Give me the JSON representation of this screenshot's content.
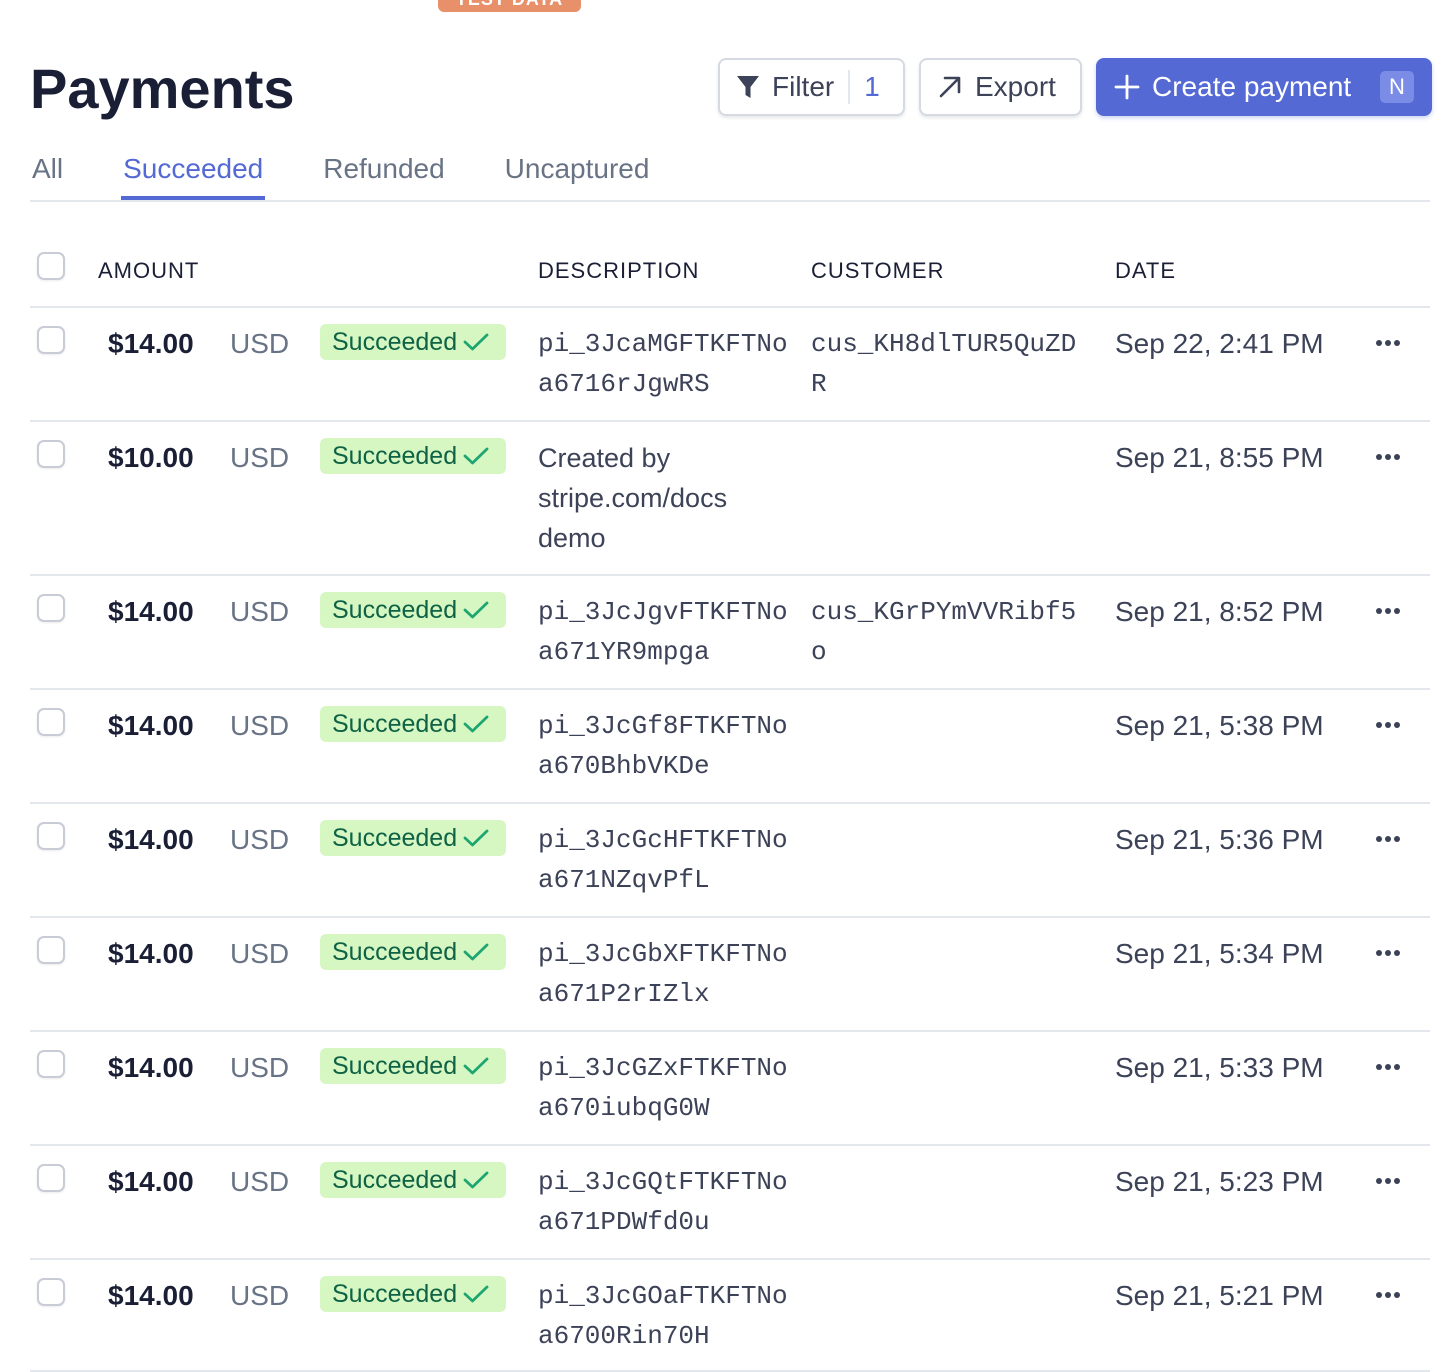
{
  "badge": "TEST DATA",
  "page_title": "Payments",
  "toolbar": {
    "filter_label": "Filter",
    "filter_count": "1",
    "export_label": "Export",
    "create_label": "Create payment",
    "create_shortcut": "N"
  },
  "tabs": [
    {
      "label": "All",
      "active": false
    },
    {
      "label": "Succeeded",
      "active": true
    },
    {
      "label": "Refunded",
      "active": false
    },
    {
      "label": "Uncaptured",
      "active": false
    }
  ],
  "columns": {
    "amount": "AMOUNT",
    "description": "DESCRIPTION",
    "customer": "CUSTOMER",
    "date": "DATE"
  },
  "colors": {
    "accent": "#5469d4",
    "status_bg": "#d7f7c2",
    "status_text": "#0e6245",
    "badge": "#e8906a"
  },
  "rows": [
    {
      "amount": "$14.00",
      "currency": "USD",
      "status": "Succeeded",
      "description": "pi_3JcaMGFTKFTNoa6716rJgwRS",
      "description_mono": true,
      "customer": "cus_KH8dlTUR5QuZDR",
      "date": "Sep 22, 2:41 PM"
    },
    {
      "amount": "$10.00",
      "currency": "USD",
      "status": "Succeeded",
      "description": "Created by stripe.com/docs demo",
      "description_mono": false,
      "customer": "",
      "date": "Sep 21, 8:55 PM"
    },
    {
      "amount": "$14.00",
      "currency": "USD",
      "status": "Succeeded",
      "description": "pi_3JcJgvFTKFTNoa671YR9mpga",
      "description_mono": true,
      "customer": "cus_KGrPYmVVRibf5o",
      "date": "Sep 21, 8:52 PM"
    },
    {
      "amount": "$14.00",
      "currency": "USD",
      "status": "Succeeded",
      "description": "pi_3JcGf8FTKFTNoa670BhbVKDe",
      "description_mono": true,
      "customer": "",
      "date": "Sep 21, 5:38 PM"
    },
    {
      "amount": "$14.00",
      "currency": "USD",
      "status": "Succeeded",
      "description": "pi_3JcGcHFTKFTNoa671NZqvPfL",
      "description_mono": true,
      "customer": "",
      "date": "Sep 21, 5:36 PM"
    },
    {
      "amount": "$14.00",
      "currency": "USD",
      "status": "Succeeded",
      "description": "pi_3JcGbXFTKFTNoa671P2rIZlx",
      "description_mono": true,
      "customer": "",
      "date": "Sep 21, 5:34 PM"
    },
    {
      "amount": "$14.00",
      "currency": "USD",
      "status": "Succeeded",
      "description": "pi_3JcGZxFTKFTNoa670iubqG0W",
      "description_mono": true,
      "customer": "",
      "date": "Sep 21, 5:33 PM"
    },
    {
      "amount": "$14.00",
      "currency": "USD",
      "status": "Succeeded",
      "description": "pi_3JcGQtFTKFTNoa671PDWfd0u",
      "description_mono": true,
      "customer": "",
      "date": "Sep 21, 5:23 PM"
    },
    {
      "amount": "$14.00",
      "currency": "USD",
      "status": "Succeeded",
      "description": "pi_3JcGOaFTKFTNoa6700Rin70H",
      "description_mono": true,
      "customer": "",
      "date": "Sep 21, 5:21 PM"
    }
  ]
}
